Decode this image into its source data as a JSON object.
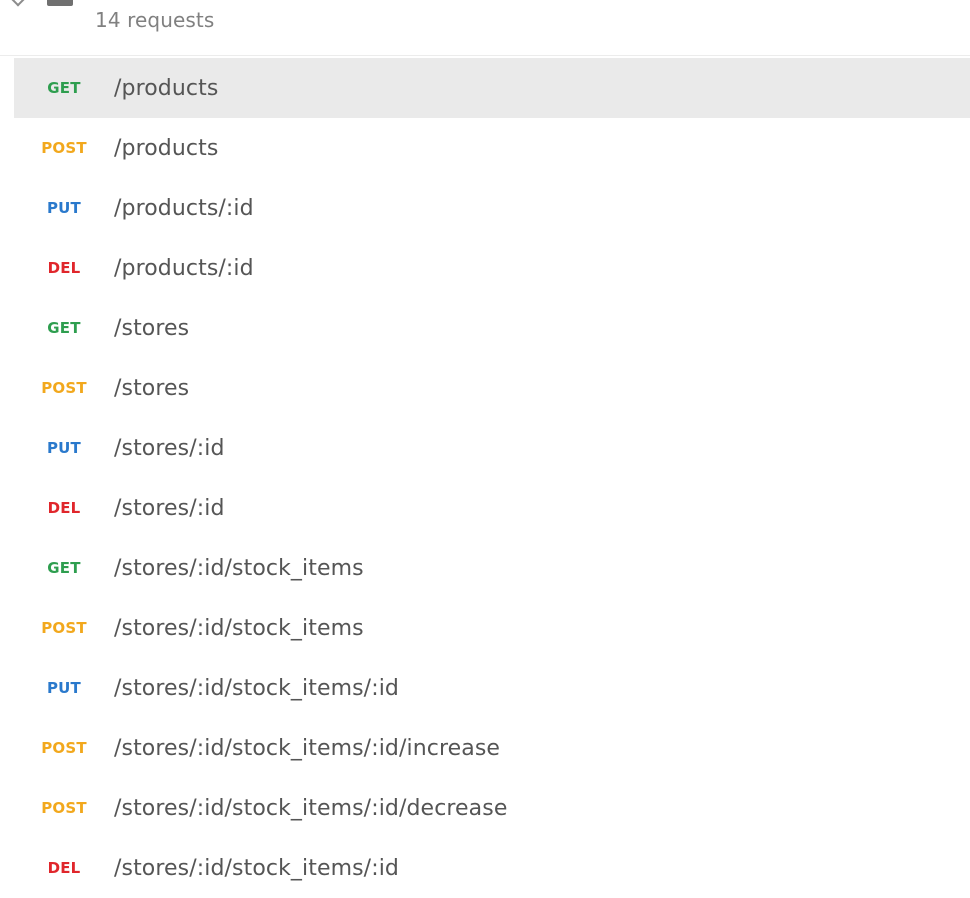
{
  "collection": {
    "request_count_label": "14 requests"
  },
  "requests": [
    {
      "method": "GET",
      "path": "/products"
    },
    {
      "method": "POST",
      "path": "/products"
    },
    {
      "method": "PUT",
      "path": "/products/:id"
    },
    {
      "method": "DEL",
      "path": "/products/:id"
    },
    {
      "method": "GET",
      "path": "/stores"
    },
    {
      "method": "POST",
      "path": "/stores"
    },
    {
      "method": "PUT",
      "path": "/stores/:id"
    },
    {
      "method": "DEL",
      "path": "/stores/:id"
    },
    {
      "method": "GET",
      "path": "/stores/:id/stock_items"
    },
    {
      "method": "POST",
      "path": "/stores/:id/stock_items"
    },
    {
      "method": "PUT",
      "path": "/stores/:id/stock_items/:id"
    },
    {
      "method": "POST",
      "path": "/stores/:id/stock_items/:id/increase"
    },
    {
      "method": "POST",
      "path": "/stores/:id/stock_items/:id/decrease"
    },
    {
      "method": "DEL",
      "path": "/stores/:id/stock_items/:id"
    }
  ],
  "colors": {
    "get": "#2e9e4f",
    "post": "#f2a81d",
    "put": "#2a79cc",
    "del": "#e0262b",
    "selected_row_bg": "#eaeaea"
  },
  "icons": {
    "collapse": "chevron-down-icon",
    "folder": "folder-icon"
  }
}
